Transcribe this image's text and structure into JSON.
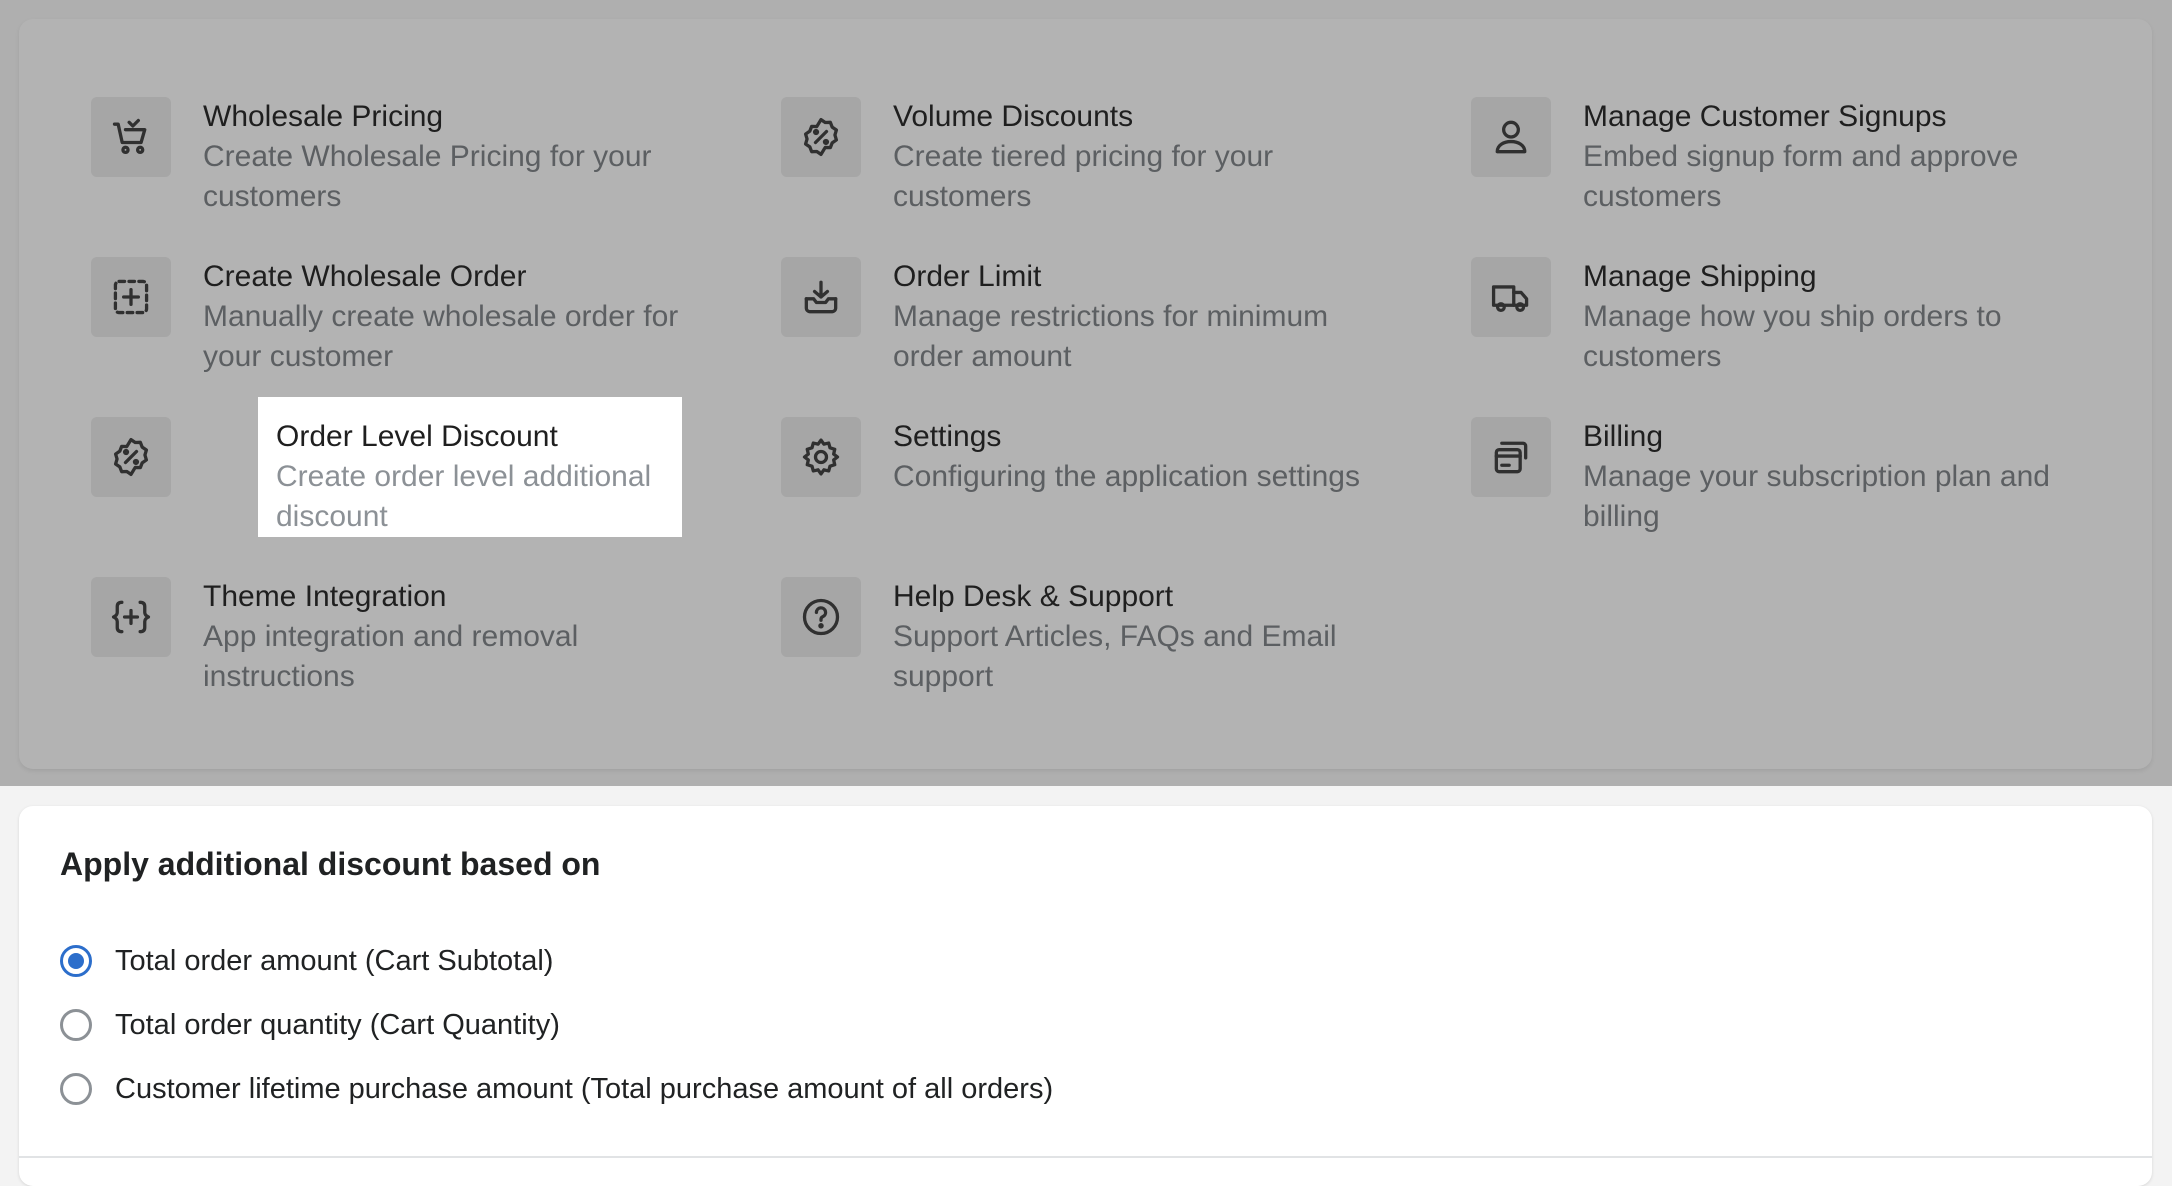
{
  "menu": {
    "items": [
      {
        "title": "Wholesale Pricing",
        "desc": "Create Wholesale Pricing for your customers",
        "icon": "cart-icon"
      },
      {
        "title": "Volume Discounts",
        "desc": "Create tiered pricing for your customers",
        "icon": "discount-badge-icon"
      },
      {
        "title": "Manage Customer Signups",
        "desc": "Embed signup form and approve customers",
        "icon": "person-icon"
      },
      {
        "title": "Create Wholesale Order",
        "desc": "Manually create wholesale order for your customer",
        "icon": "add-order-icon"
      },
      {
        "title": "Order Limit",
        "desc": "Manage restrictions for minimum order amount",
        "icon": "inbox-download-icon"
      },
      {
        "title": "Manage Shipping",
        "desc": "Manage how you ship orders to customers",
        "icon": "truck-icon"
      },
      {
        "title": "Order Level Discount",
        "desc": "Create order level additional discount",
        "icon": "discount-badge-icon"
      },
      {
        "title": "Settings",
        "desc": "Configuring the application settings",
        "icon": "gear-icon"
      },
      {
        "title": "Billing",
        "desc": "Manage your subscription plan and billing",
        "icon": "billing-cards-icon"
      },
      {
        "title": "Theme Integration",
        "desc": "App integration and removal instructions",
        "icon": "code-braces-icon"
      },
      {
        "title": "Help Desk & Support",
        "desc": "Support Articles, FAQs and Email support",
        "icon": "question-circle-icon"
      }
    ]
  },
  "discount_basis": {
    "title": "Apply additional discount based on",
    "options": [
      {
        "label": "Total order amount (Cart Subtotal)",
        "selected": true
      },
      {
        "label": "Total order quantity (Cart Quantity)",
        "selected": false
      },
      {
        "label": "Customer lifetime purchase amount (Total purchase amount of all orders)",
        "selected": false
      }
    ]
  },
  "colors": {
    "accent": "#2c6ecb",
    "overlay": "#b3b3b3"
  }
}
